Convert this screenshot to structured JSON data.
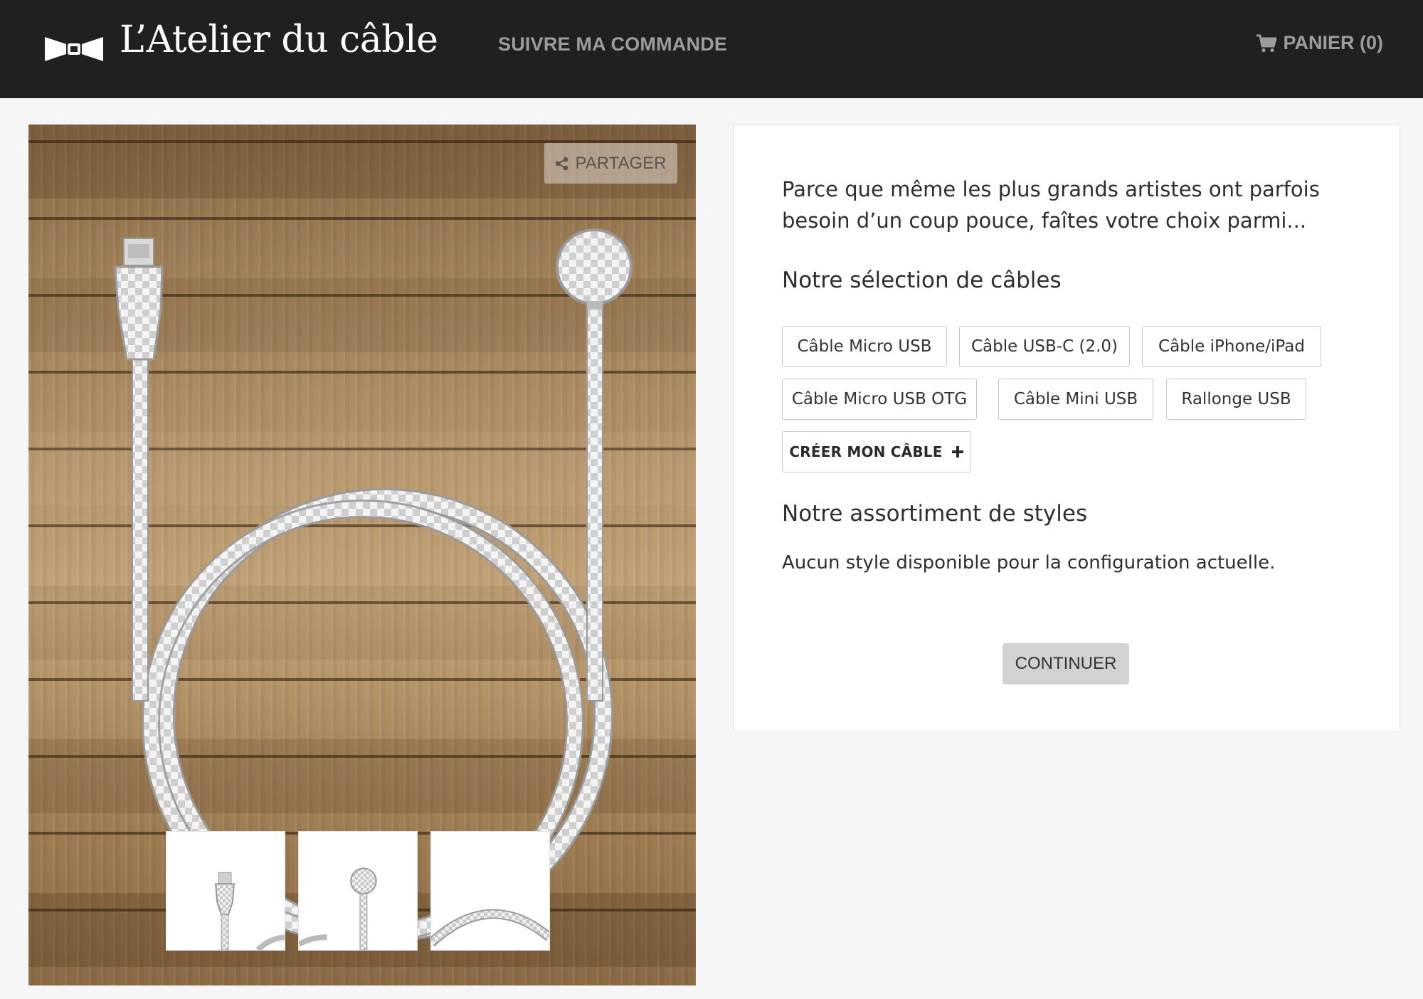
{
  "header": {
    "brand": "L’Atelier du câble",
    "nav_track_order": "SUIVRE MA COMMANDE",
    "cart_label": "PANIER (0)"
  },
  "preview": {
    "share_label": "PARTAGER",
    "thumbnails": [
      "connector-a-view",
      "connector-b-view",
      "cable-view"
    ]
  },
  "panel": {
    "intro": "Parce que même les plus grands artistes ont parfois besoin d’un coup pouce, faîtes votre choix parmi...",
    "cables_heading": "Notre sélection de câbles",
    "cable_options": [
      "Câble Micro USB",
      "Câble USB-C (2.0)",
      "Câble iPhone/iPad",
      "Câble Micro USB OTG",
      "Câble Mini USB",
      "Rallonge USB"
    ],
    "create_label": "CRÉER MON CÂBLE",
    "styles_heading": "Notre assortiment de styles",
    "no_style_text": "Aucun style disponible pour la configuration actuelle.",
    "continue_label": "CONTINUER"
  },
  "colors": {
    "header_bg": "#1f211f",
    "nav_text": "#9b9d9b",
    "page_bg": "#f6f6f6",
    "panel_border": "#e1e1e1",
    "continue_bg": "#d2d2d2"
  },
  "icons": [
    "bowtie-logo-icon",
    "cart-icon",
    "share-icon",
    "plus-icon"
  ]
}
